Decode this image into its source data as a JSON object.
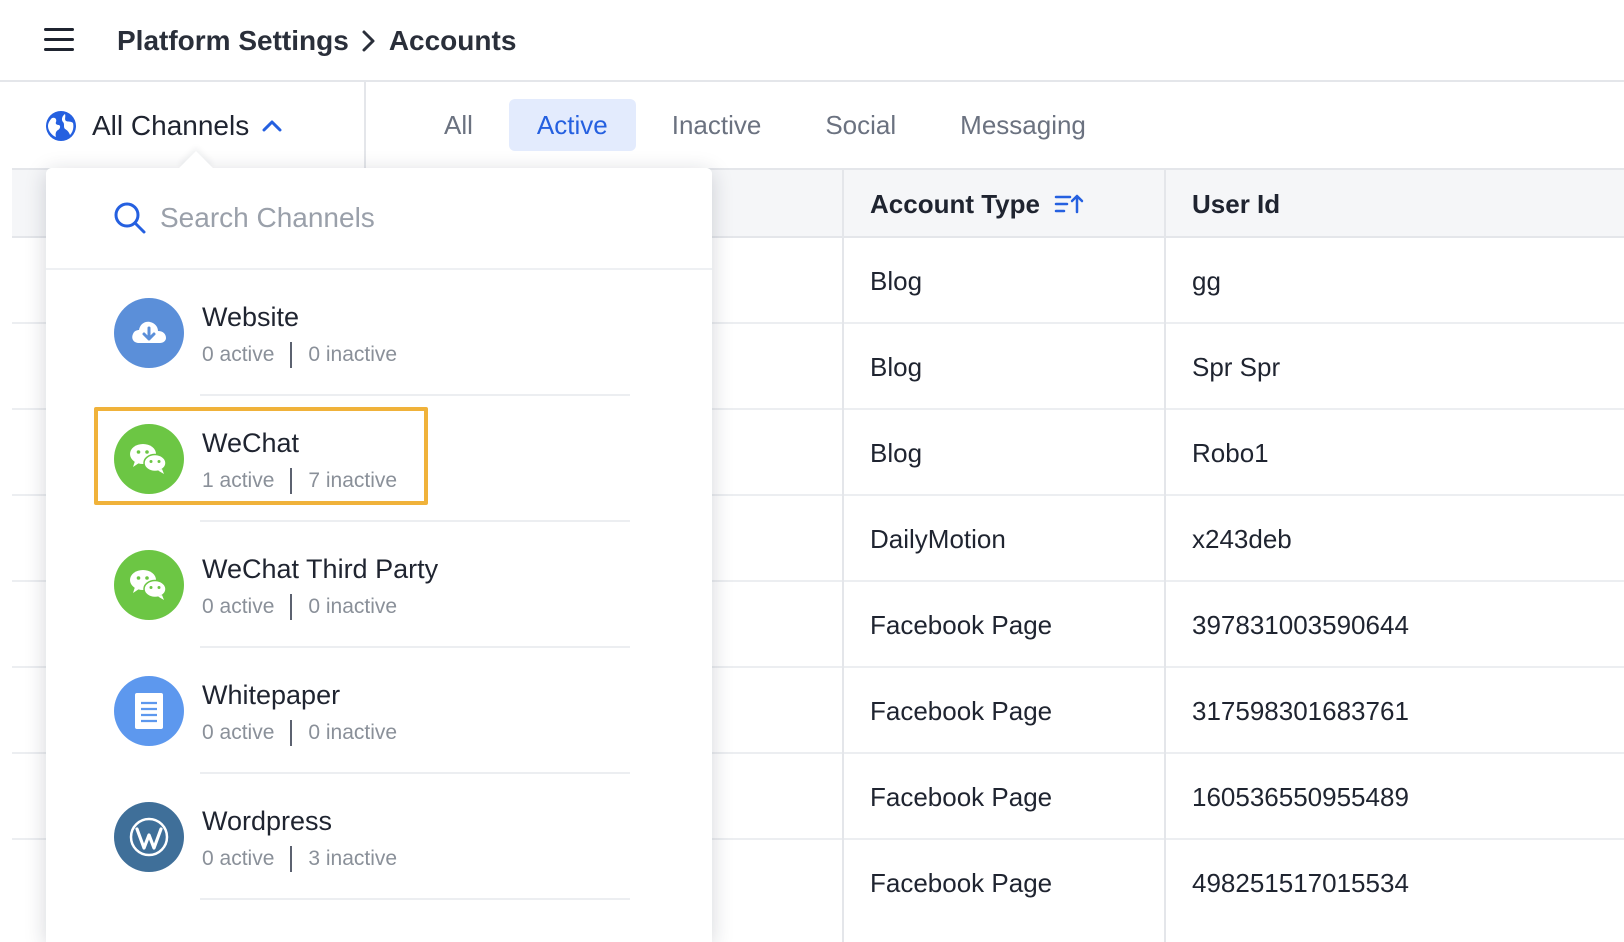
{
  "header": {
    "breadcrumb_parent": "Platform Settings",
    "breadcrumb_current": "Accounts"
  },
  "toolbar": {
    "channel_picker_label": "All Channels",
    "tabs": [
      {
        "label": "All",
        "active": false
      },
      {
        "label": "Active",
        "active": true
      },
      {
        "label": "Inactive",
        "active": false
      },
      {
        "label": "Social",
        "active": false
      },
      {
        "label": "Messaging",
        "active": false
      }
    ]
  },
  "table": {
    "columns": [
      "Account Type",
      "User Id"
    ],
    "rows": [
      {
        "account_type": "Blog",
        "user_id": "gg"
      },
      {
        "account_type": "Blog",
        "user_id": "Spr Spr"
      },
      {
        "account_type": "Blog",
        "user_id": "Robo1"
      },
      {
        "account_type": "DailyMotion",
        "user_id": "x243deb"
      },
      {
        "account_type": "Facebook Page",
        "user_id": "397831003590644"
      },
      {
        "account_type": "Facebook Page",
        "user_id": "317598301683761"
      },
      {
        "account_type": "Facebook Page",
        "user_id": "160536550955489"
      },
      {
        "account_type": "Facebook Page",
        "user_id": "498251517015534"
      }
    ]
  },
  "dropdown": {
    "search_placeholder": "Search Channels",
    "channels": [
      {
        "name": "Website",
        "active": "0 active",
        "inactive": "0 inactive",
        "icon": "cloud-download-icon",
        "color": "#5b8fd9"
      },
      {
        "name": "WeChat",
        "active": "1 active",
        "inactive": "7 inactive",
        "icon": "wechat-icon",
        "color": "#6cc644"
      },
      {
        "name": "WeChat Third Party",
        "active": "0 active",
        "inactive": "0 inactive",
        "icon": "wechat-icon",
        "color": "#6cc644"
      },
      {
        "name": "Whitepaper",
        "active": "0 active",
        "inactive": "0 inactive",
        "icon": "document-icon",
        "color": "#5d98ee"
      },
      {
        "name": "Wordpress",
        "active": "0 active",
        "inactive": "3 inactive",
        "icon": "wordpress-icon",
        "color": "#3f6f99"
      }
    ]
  },
  "colors": {
    "accent": "#2560e0",
    "active_tab_bg": "#e3ebfd",
    "highlight": "#f0b23a"
  }
}
